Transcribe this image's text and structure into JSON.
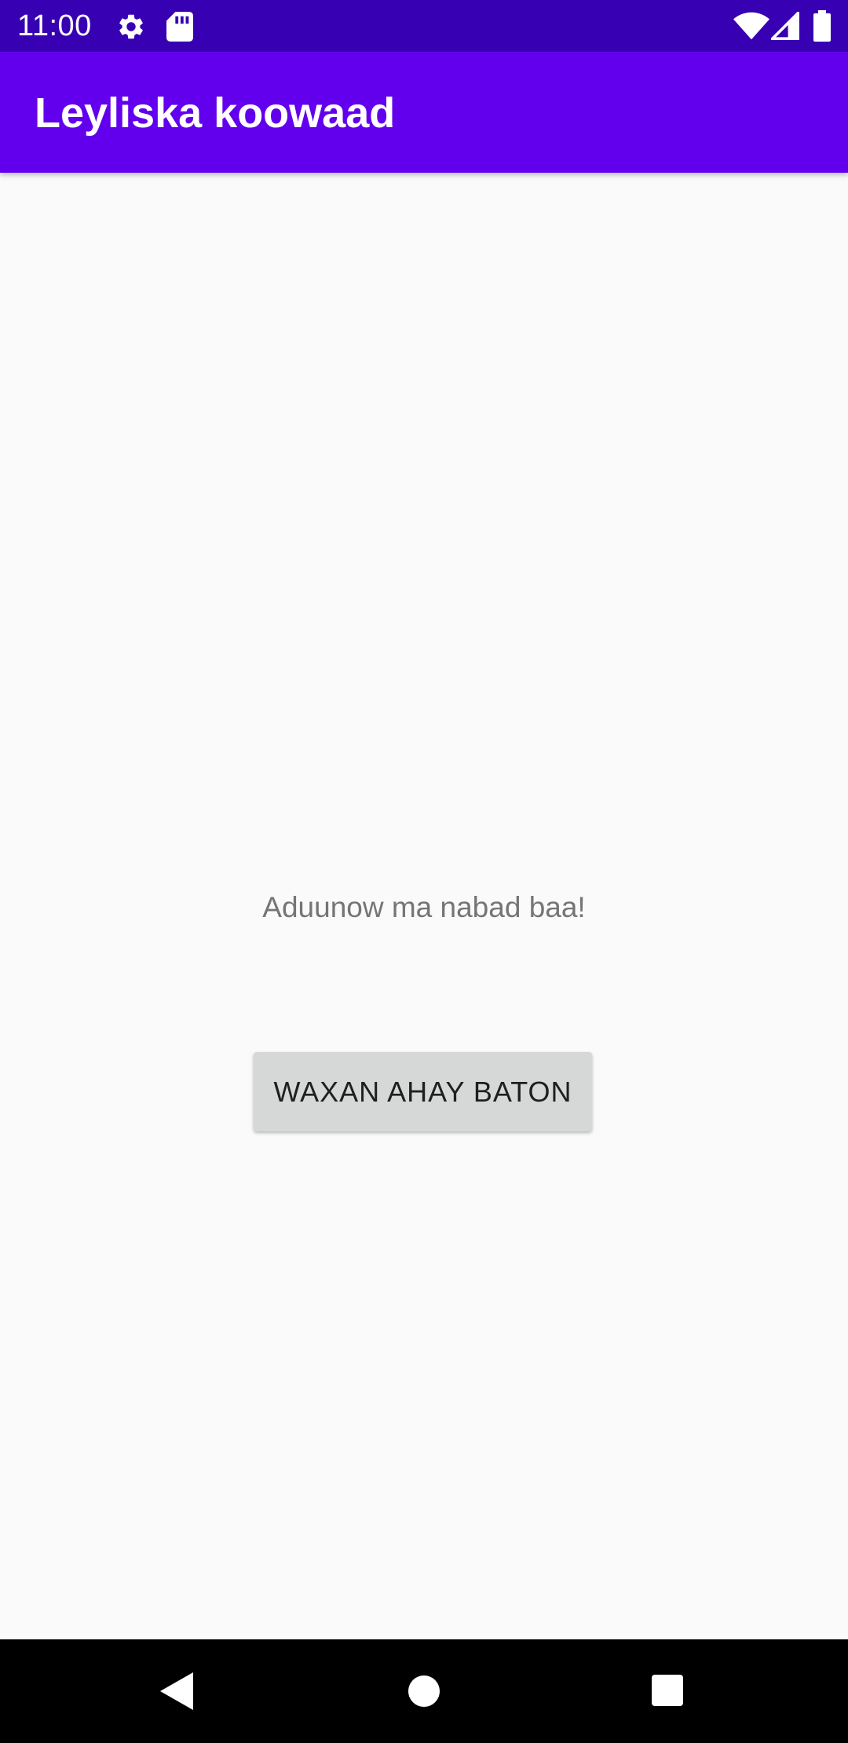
{
  "status_bar": {
    "time": "11:00",
    "icons": [
      "settings-icon",
      "sd-card-icon",
      "wifi-icon",
      "cellular-signal-icon",
      "battery-icon"
    ]
  },
  "app_bar": {
    "title": "Leyliska koowaad"
  },
  "main": {
    "greeting": "Aduunow ma nabad baa!",
    "button_label": "WAXAN AHAY BATON"
  },
  "nav_bar": {
    "buttons": [
      "back-icon",
      "home-icon",
      "recents-icon"
    ]
  },
  "colors": {
    "status_bar": "#3700b3",
    "app_bar": "#6200ee",
    "background": "#fafafa",
    "button": "#d6d7d7",
    "greeting_text": "#757575",
    "nav_bar": "#000000"
  }
}
